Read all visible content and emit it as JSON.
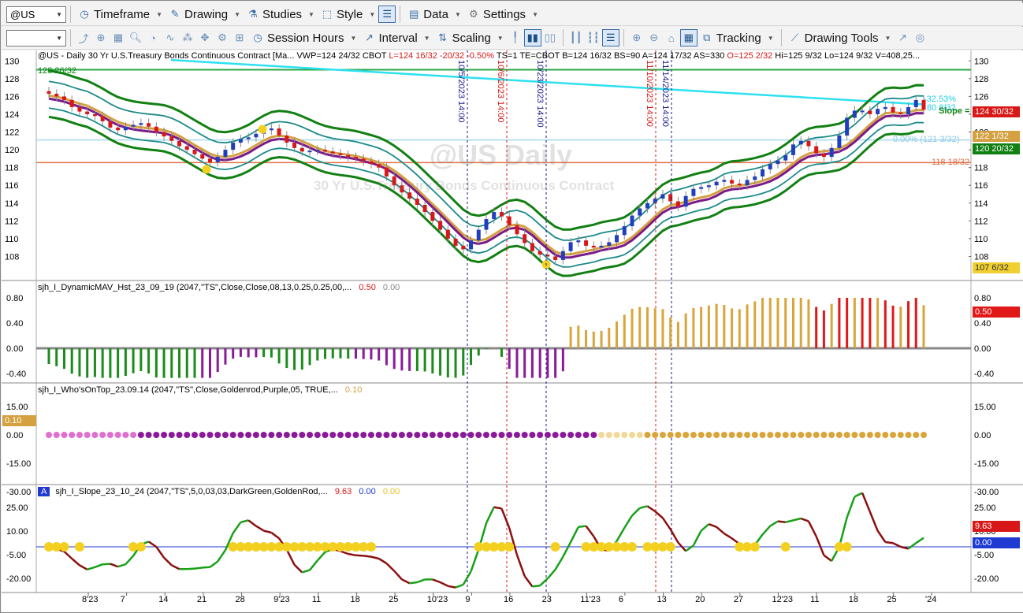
{
  "toolbar1": {
    "symbol": "@US",
    "items": [
      {
        "label": "Timeframe",
        "icon": "clock-icon"
      },
      {
        "label": "Drawing",
        "icon": "pencil-icon"
      },
      {
        "label": "Studies",
        "icon": "flask-icon"
      },
      {
        "label": "Style",
        "icon": "style-icon"
      },
      {
        "label": "Data",
        "icon": "data-icon"
      },
      {
        "label": "Settings",
        "icon": "gear-icon"
      }
    ]
  },
  "toolbar2": {
    "session": "Session Hours",
    "interval": "Interval",
    "scaling": "Scaling",
    "tracking": "Tracking",
    "drawing_tools": "Drawing Tools"
  },
  "colors": {
    "up": "#1f3fbf",
    "down": "#d81818",
    "green": "#128012",
    "teal": "#1c8a8a",
    "gold": "#d4a040",
    "purple": "#7a1a8a",
    "cyan": "#2ee0f0",
    "red_line": "#e0704a",
    "lightblue": "#a8d8ee",
    "hist_green": "#1a8c1a",
    "hist_purple": "#8a1a9a",
    "hist_gold": "#d9a53a",
    "hist_red": "#e01818",
    "slope_red": "#8b1010",
    "slope_green": "#18a018"
  },
  "panes": {
    "price": {
      "header_parts": [
        {
          "text": "@US - Daily  30 Yr U.S.Treasury Bonds Continuous Contract [Ma...  VWP=124 24/32  CBOT",
          "color": "#000"
        },
        {
          "text": "  L=124 16/32  -20/32  -0.50%",
          "color": "#d81818"
        },
        {
          "text": "  TS=1  TE=CBOT  B=124 16/32  BS=90  A=124 17/32  AS=330",
          "color": "#000"
        },
        {
          "text": "  O=125 2/32",
          "color": "#d81818"
        },
        {
          "text": "  Hi=125 9/32  Lo=124 9/32  V=408,25...",
          "color": "#000"
        }
      ],
      "watermark_title": "@US Daily",
      "watermark_sub": "30 Yr U.S.Treasury Bonds Continuous Contract",
      "y_ticks": [
        "130",
        "128",
        "126",
        "124",
        "122",
        "120",
        "118",
        "116",
        "114",
        "112",
        "110",
        "108"
      ],
      "top_left_label": "128 26/32",
      "price_tags": [
        {
          "text": "124 30/32",
          "bg": "#d81818"
        },
        {
          "text": "122 1/32",
          "bg": "#d4a040"
        },
        {
          "text": "120 20/32",
          "bg": "#128012"
        },
        {
          "text": "107 6/32",
          "bg": "#f0d030",
          "fg": "#333"
        }
      ],
      "line_labels": {
        "pct": "-32.53%",
        "pct2": "80 8/32",
        "slope": "Slope =",
        "fib": "0.00% (121 3/32)",
        "red_level": "118 18/32"
      },
      "event_labels": [
        {
          "text": "10/5/2023 14:00",
          "color": "#1a1a8a"
        },
        {
          "text": "10/6/2023 14:00",
          "color": "#d81818"
        },
        {
          "text": "10/23/2023 14:00",
          "color": "#1a1a8a"
        },
        {
          "text": "11/10/2023 14:00",
          "color": "#d81818"
        },
        {
          "text": "11/14/2023 14:00",
          "color": "#1a1a8a"
        }
      ]
    },
    "dynamic_mav": {
      "header": "sjh_I_DynamicMAV_Hst_23_09_19 (2047,\"TS\",Close,Close,08,13,0.25,0.25,00,...",
      "v1": "0.50",
      "v2": "0.00",
      "y_ticks": [
        "0.80",
        "0.40",
        "0.00",
        "-0.40"
      ],
      "tag": "0.50",
      "tag0": "0.00"
    },
    "whos_on_top": {
      "header": "sjh_I_Who'sOnTop_23.09.14 (2047,\"TS\",Close,Goldenrod,Purple,05,  TRUE,...",
      "v1": "0.10",
      "y_ticks": [
        "15.00",
        "0.00",
        "-15.00",
        "-30.00"
      ],
      "left_tag": "0.10"
    },
    "slope": {
      "badge": "A",
      "header": "sjh_I_Slope_23_10_24 (2047,\"TS\",5,0,03,03,DarkGreen,GoldenRod,...",
      "v1": "9.63",
      "v2": "0.00",
      "v3": "0.00",
      "y_ticks": [
        "25.00",
        "10.00",
        "-5.00",
        "-20.00"
      ],
      "tag1": "9.63",
      "tag2": "0.00"
    }
  },
  "x_axis": {
    "labels": [
      "8'23",
      "7",
      "14",
      "21",
      "28",
      "9'23",
      "11",
      "18",
      "25",
      "10'23",
      "9",
      "16",
      "23",
      "11'23",
      "6",
      "13",
      "20",
      "27",
      "12'23",
      "11",
      "18",
      "25",
      "'24"
    ]
  },
  "chart_data": {
    "type": "candlestick",
    "title": "@US - Daily  30 Yr U.S.Treasury Bonds Continuous Contract",
    "ylim": [
      106,
      131
    ],
    "close": [
      126.3,
      126.0,
      125.6,
      124.8,
      124.3,
      124.0,
      123.8,
      123.2,
      122.5,
      122.2,
      122.6,
      122.8,
      123.0,
      122.6,
      122.0,
      121.5,
      121.0,
      120.4,
      120.0,
      119.5,
      119.0,
      118.6,
      119.2,
      120.0,
      120.8,
      121.2,
      121.4,
      121.8,
      122.2,
      122.4,
      121.6,
      120.8,
      120.2,
      119.8,
      119.9,
      120.0,
      119.8,
      119.6,
      119.4,
      119.2,
      119.0,
      118.7,
      118.4,
      118.0,
      117.0,
      116.0,
      115.2,
      114.5,
      113.8,
      113.0,
      112.0,
      111.0,
      110.0,
      109.2,
      108.8,
      109.8,
      111.0,
      112.2,
      113.0,
      112.5,
      111.5,
      110.5,
      109.5,
      108.6,
      108.2,
      108.0,
      107.6,
      108.6,
      109.6,
      109.8,
      109.2,
      109.0,
      109.2,
      109.6,
      110.4,
      111.4,
      112.6,
      113.4,
      114.0,
      114.5,
      115.0,
      114.2,
      113.6,
      114.8,
      115.6,
      115.8,
      116.0,
      116.4,
      116.6,
      116.2,
      116.0,
      116.6,
      117.0,
      117.8,
      118.4,
      118.8,
      119.4,
      120.6,
      121.0,
      120.4,
      119.6,
      119.2,
      120.2,
      121.6,
      123.6,
      124.4,
      124.4,
      124.0,
      124.6,
      124.8,
      124.2,
      124.0,
      124.8,
      125.6,
      124.5
    ],
    "series": [
      {
        "name": "Upper band",
        "color": "#128012"
      },
      {
        "name": "Teal band",
        "color": "#1c8a8a"
      },
      {
        "name": "Goldenrod MA",
        "color": "#d4a040"
      },
      {
        "name": "Purple MA",
        "color": "#7a1a8a"
      }
    ],
    "levels": [
      129.0,
      121.1,
      118.56
    ],
    "histogram_range": [
      -0.5,
      0.85
    ],
    "slope_range": [
      -25,
      30
    ]
  }
}
